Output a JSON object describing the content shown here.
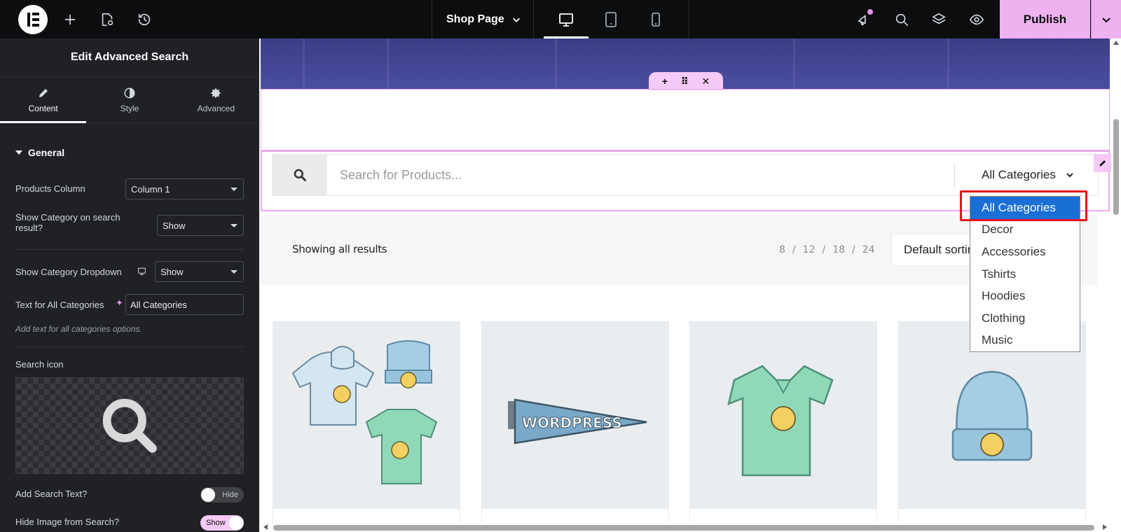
{
  "topbar": {
    "page_name": "Shop Page",
    "publish_label": "Publish",
    "icons": [
      "elementor-logo-icon",
      "add-element-icon",
      "page-settings-icon",
      "history-icon",
      "chevron-down-icon",
      "desktop-icon",
      "tablet-icon",
      "mobile-icon",
      "whats-new-icon",
      "search-icon",
      "structure-icon",
      "preview-icon"
    ],
    "active_device": "desktop"
  },
  "panel": {
    "title": "Edit Advanced Search",
    "tabs": [
      {
        "label": "Content",
        "icon": "pencil-icon",
        "active": true
      },
      {
        "label": "Style",
        "icon": "half-circle-icon",
        "active": false
      },
      {
        "label": "Advanced",
        "icon": "gear-icon",
        "active": false
      }
    ],
    "section_title": "General",
    "controls": {
      "products_column": {
        "label": "Products Column",
        "value": "Column 1"
      },
      "show_category_result": {
        "label": "Show Category on search result?",
        "value": "Show"
      },
      "show_category_dropdown": {
        "label": "Show Category Dropdown",
        "value": "Show"
      },
      "all_categories_text": {
        "label": "Text for All Categories",
        "value": "All Categories",
        "help": "Add text for all categories options."
      },
      "search_icon": {
        "label": "Search icon"
      },
      "add_search_text": {
        "label": "Add Search Text?",
        "toggle": "Hide",
        "on": false
      },
      "hide_image": {
        "label": "Hide Image from Search?",
        "toggle": "Show",
        "on": true
      }
    }
  },
  "canvas": {
    "search_placeholder": "Search for Products...",
    "category_select": "All Categories",
    "results_text": "Showing all results",
    "per_page": [
      "8",
      "/",
      "12",
      "/",
      "18",
      "/",
      "24"
    ],
    "sort_label": "Default sorting",
    "products": [
      {
        "name": "hoodie-beanie-tshirt-product-image"
      },
      {
        "name": "wordpress-pennant-product-image"
      },
      {
        "name": "vneck-tshirt-product-image"
      },
      {
        "name": "beanie-product-image"
      }
    ],
    "pennant_text": "WORDPRESS"
  },
  "dropdown": {
    "options": [
      "All Categories",
      "Decor",
      "Accessories",
      "Tshirts",
      "Hoodies",
      "Clothing",
      "Music"
    ],
    "selected_index": 0
  },
  "colors": {
    "accent": "#eeb2f0",
    "topbar_bg": "#0c0d0e",
    "panel_bg": "#1f2124",
    "dropdown_selected": "#1a6fd6",
    "highlight_box": "#e8131b",
    "hero": "#3c3d86"
  }
}
